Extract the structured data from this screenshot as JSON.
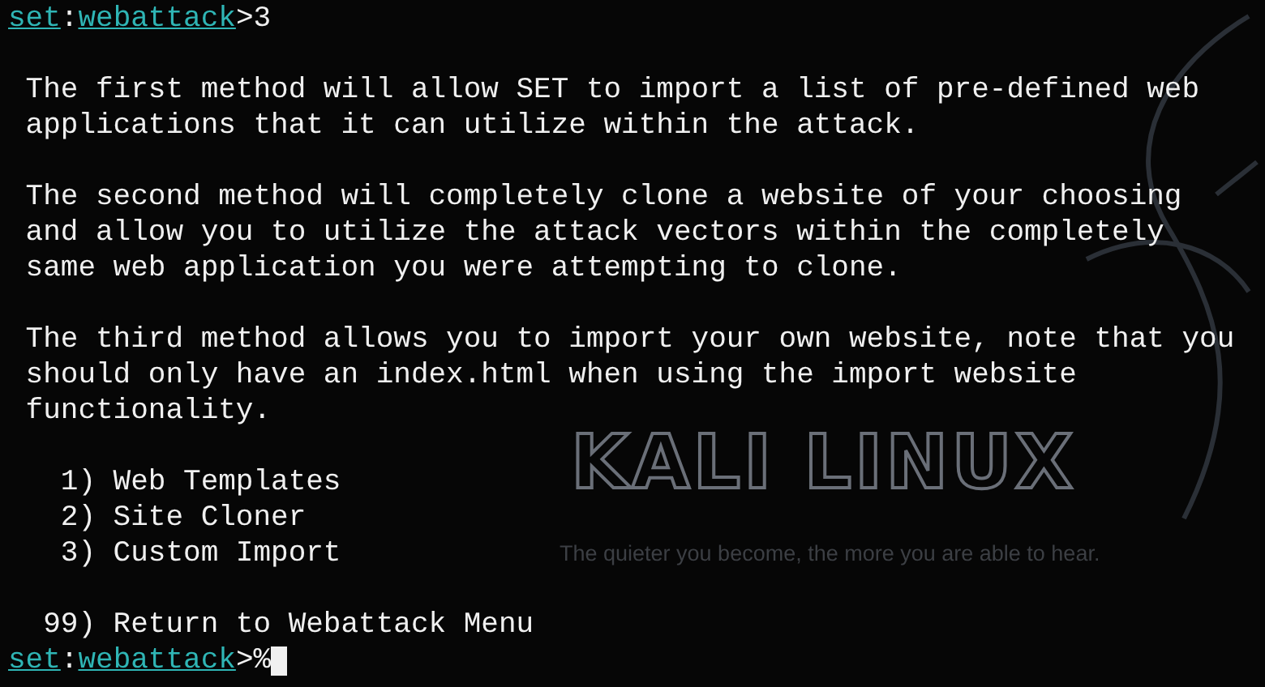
{
  "wallpaper": {
    "logo": "KALI LINUX",
    "tagline": "The quieter you become, the more you are able to hear."
  },
  "lines": [
    {
      "kind": "prompt",
      "module": "set",
      "separator": ":",
      "submodule": "webattack",
      "suffix": ">",
      "input": "3",
      "cursor": false
    },
    {
      "kind": "blank"
    },
    {
      "kind": "text",
      "text": " The first method will allow SET to import a list of pre-defined web"
    },
    {
      "kind": "text",
      "text": " applications that it can utilize within the attack."
    },
    {
      "kind": "blank"
    },
    {
      "kind": "text",
      "text": " The second method will completely clone a website of your choosing"
    },
    {
      "kind": "text",
      "text": " and allow you to utilize the attack vectors within the completely"
    },
    {
      "kind": "text",
      "text": " same web application you were attempting to clone."
    },
    {
      "kind": "blank"
    },
    {
      "kind": "text",
      "text": " The third method allows you to import your own website, note that you"
    },
    {
      "kind": "text",
      "text": " should only have an index.html when using the import website"
    },
    {
      "kind": "text",
      "text": " functionality."
    },
    {
      "kind": "blank"
    },
    {
      "kind": "option",
      "text": "   1) Web Templates"
    },
    {
      "kind": "option",
      "text": "   2) Site Cloner"
    },
    {
      "kind": "option",
      "text": "   3) Custom Import"
    },
    {
      "kind": "blank"
    },
    {
      "kind": "option",
      "text": "  99) Return to Webattack Menu"
    },
    {
      "kind": "prompt",
      "module": "set",
      "separator": ":",
      "submodule": "webattack",
      "suffix": ">",
      "input": "%",
      "cursor": true
    }
  ]
}
